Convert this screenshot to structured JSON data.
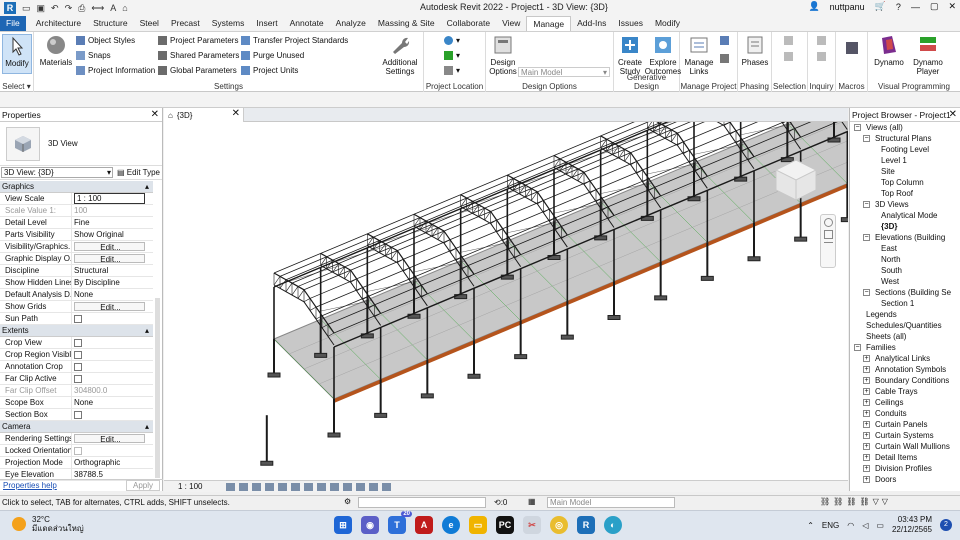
{
  "window": {
    "title": "Autodesk Revit 2022 - Project1 - 3D View: {3D}",
    "user": "nuttpanu"
  },
  "tabs": [
    "File",
    "Architecture",
    "Structure",
    "Steel",
    "Precast",
    "Systems",
    "Insert",
    "Annotate",
    "Analyze",
    "Massing & Site",
    "Collaborate",
    "View",
    "Manage",
    "Add-Ins",
    "Issues",
    "Modify"
  ],
  "active_tab": "Manage",
  "ribbon": {
    "select": {
      "modify": "Modify",
      "label": "Select"
    },
    "settings": {
      "materials": "Materials",
      "object_styles": "Object Styles",
      "snaps": "Snaps",
      "project_information": "Project Information",
      "project_parameters": "Project Parameters",
      "shared_parameters": "Shared Parameters",
      "global_parameters": "Global Parameters",
      "transfer_project_standards": "Transfer Project Standards",
      "purge_unused": "Purge Unused",
      "project_units": "Project Units",
      "additional_settings": "Additional Settings",
      "label": "Settings"
    },
    "project_location": {
      "label": "Project Location"
    },
    "design_options": {
      "button": "Design Options",
      "dropdown": "Main Model",
      "label": "Design Options"
    },
    "generative_design": {
      "create_study": "Create Study",
      "explore_outcomes": "Explore Outcomes",
      "label": "Generative Design"
    },
    "manage_project": {
      "manage_links": "Manage Links",
      "label": "Manage Project"
    },
    "phasing": {
      "phases": "Phases",
      "label": "Phasing"
    },
    "selection": {
      "label": "Selection"
    },
    "inquiry": {
      "label": "Inquiry"
    },
    "macros": {
      "label": "Macros"
    },
    "visual_programming": {
      "dynamo": "Dynamo",
      "dynamo_player": "Dynamo Player",
      "label": "Visual Programming"
    }
  },
  "properties": {
    "title": "Properties",
    "type_name": "3D View",
    "selector": "3D View: {3D}",
    "edit_type": "Edit Type",
    "sections": [
      {
        "name": "Graphics",
        "rows": [
          {
            "k": "View Scale",
            "v": "1 : 100",
            "kind": "input"
          },
          {
            "k": "Scale Value    1:",
            "v": "100",
            "kind": "dim"
          },
          {
            "k": "Detail Level",
            "v": "Fine"
          },
          {
            "k": "Parts Visibility",
            "v": "Show Original"
          },
          {
            "k": "Visibility/Graphics...",
            "v": "Edit...",
            "kind": "edit"
          },
          {
            "k": "Graphic Display O...",
            "v": "Edit...",
            "kind": "edit"
          },
          {
            "k": "Discipline",
            "v": "Structural"
          },
          {
            "k": "Show Hidden Lines",
            "v": "By Discipline"
          },
          {
            "k": "Default Analysis D...",
            "v": "None"
          },
          {
            "k": "Show Grids",
            "v": "Edit...",
            "kind": "edit"
          },
          {
            "k": "Sun Path",
            "v": "",
            "kind": "check"
          }
        ]
      },
      {
        "name": "Extents",
        "rows": [
          {
            "k": "Crop View",
            "v": "",
            "kind": "check"
          },
          {
            "k": "Crop Region Visible",
            "v": "",
            "kind": "check"
          },
          {
            "k": "Annotation Crop",
            "v": "",
            "kind": "check"
          },
          {
            "k": "Far Clip Active",
            "v": "",
            "kind": "check"
          },
          {
            "k": "Far Clip Offset",
            "v": "304800.0",
            "kind": "dim"
          },
          {
            "k": "Scope Box",
            "v": "None"
          },
          {
            "k": "Section Box",
            "v": "",
            "kind": "check"
          }
        ]
      },
      {
        "name": "Camera",
        "rows": [
          {
            "k": "Rendering Settings",
            "v": "Edit...",
            "kind": "edit"
          },
          {
            "k": "Locked Orientation",
            "v": "",
            "kind": "checkdim"
          },
          {
            "k": "Projection Mode",
            "v": "Orthographic"
          },
          {
            "k": "Eye Elevation",
            "v": "38788.5"
          }
        ]
      }
    ],
    "help": "Properties help",
    "apply": "Apply"
  },
  "view_tab": "{3D}",
  "view_scale": "1 : 100",
  "browser": {
    "title": "Project Browser - Project1",
    "nodes": [
      {
        "t": "Views (all)",
        "lvl": 0,
        "tg": "-"
      },
      {
        "t": "Structural Plans",
        "lvl": 1,
        "tg": "-"
      },
      {
        "t": "Footing Level",
        "lvl": 3
      },
      {
        "t": "Level 1",
        "lvl": 3
      },
      {
        "t": "Site",
        "lvl": 3
      },
      {
        "t": "Top Column",
        "lvl": 3
      },
      {
        "t": "Top Roof",
        "lvl": 3
      },
      {
        "t": "3D Views",
        "lvl": 1,
        "tg": "-"
      },
      {
        "t": "Analytical Mode",
        "lvl": 3
      },
      {
        "t": "{3D}",
        "lvl": 3,
        "bold": true
      },
      {
        "t": "Elevations (Building",
        "lvl": 1,
        "tg": "-"
      },
      {
        "t": "East",
        "lvl": 3
      },
      {
        "t": "North",
        "lvl": 3
      },
      {
        "t": "South",
        "lvl": 3
      },
      {
        "t": "West",
        "lvl": 3
      },
      {
        "t": "Sections (Building Se",
        "lvl": 1,
        "tg": "-"
      },
      {
        "t": "Section 1",
        "lvl": 3
      },
      {
        "t": "Legends",
        "lvl": 0
      },
      {
        "t": "Schedules/Quantities",
        "lvl": 0
      },
      {
        "t": "Sheets (all)",
        "lvl": 0
      },
      {
        "t": "Families",
        "lvl": 0,
        "tg": "-"
      },
      {
        "t": "Analytical Links",
        "lvl": 1,
        "tg": "+"
      },
      {
        "t": "Annotation Symbols",
        "lvl": 1,
        "tg": "+"
      },
      {
        "t": "Boundary Conditions",
        "lvl": 1,
        "tg": "+"
      },
      {
        "t": "Cable Trays",
        "lvl": 1,
        "tg": "+"
      },
      {
        "t": "Ceilings",
        "lvl": 1,
        "tg": "+"
      },
      {
        "t": "Conduits",
        "lvl": 1,
        "tg": "+"
      },
      {
        "t": "Curtain Panels",
        "lvl": 1,
        "tg": "+"
      },
      {
        "t": "Curtain Systems",
        "lvl": 1,
        "tg": "+"
      },
      {
        "t": "Curtain Wall Mullions",
        "lvl": 1,
        "tg": "+"
      },
      {
        "t": "Detail Items",
        "lvl": 1,
        "tg": "+"
      },
      {
        "t": "Division Profiles",
        "lvl": 1,
        "tg": "+"
      },
      {
        "t": "Doors",
        "lvl": 1,
        "tg": "+"
      }
    ]
  },
  "status": {
    "message": "Click to select, TAB for alternates, CTRL adds, SHIFT unselects.",
    "zero": ":0",
    "model": "Main Model"
  },
  "taskbar": {
    "temp": "32°C",
    "weather": "มีแดดส่วนใหญ่",
    "lang": "ENG",
    "time": "03:43 PM",
    "date": "22/12/2565",
    "notif": "2",
    "badge": "20"
  },
  "colors": {
    "accent": "#1e66b4",
    "steel": "#1a1a1a",
    "floor": "#c8c8c8",
    "beam_edge": "#b5541c",
    "grid_green": "#2aa12a"
  }
}
